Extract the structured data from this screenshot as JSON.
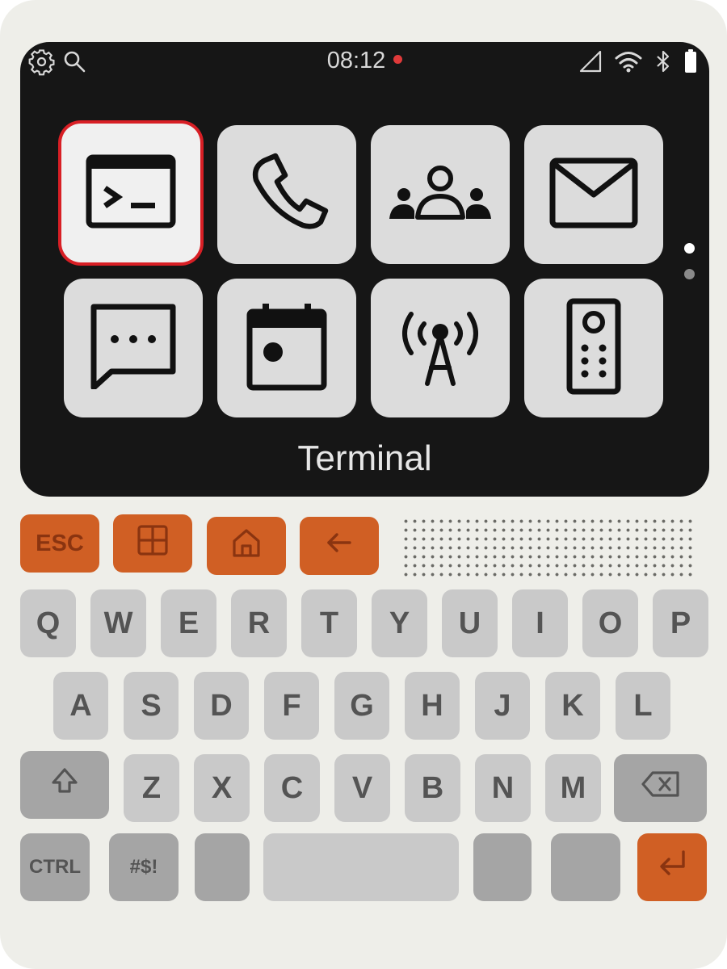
{
  "status_bar": {
    "time": "08:12",
    "icons": [
      "gear-icon",
      "search-icon",
      "cell-signal-icon",
      "wifi-icon",
      "bluetooth-icon",
      "battery-icon"
    ],
    "recording_color": "#e03a3a"
  },
  "apps": [
    {
      "icon": "terminal-icon",
      "name": "Terminal",
      "selected": true
    },
    {
      "icon": "phone-icon"
    },
    {
      "icon": "contacts-icon"
    },
    {
      "icon": "mail-icon"
    },
    {
      "icon": "messages-icon"
    },
    {
      "icon": "calendar-icon"
    },
    {
      "icon": "radio-tower-icon"
    },
    {
      "icon": "remote-icon"
    }
  ],
  "selected_app_label": "Terminal",
  "pager": {
    "pages": 2,
    "current": 1
  },
  "function_keys": [
    {
      "label": "ESC"
    },
    {
      "icon": "grid-icon"
    },
    {
      "icon": "home-icon"
    },
    {
      "icon": "back-arrow-icon"
    }
  ],
  "keyboard": {
    "row1": [
      "Q",
      "W",
      "E",
      "R",
      "T",
      "Y",
      "U",
      "I",
      "O",
      "P"
    ],
    "row2": [
      "A",
      "S",
      "D",
      "F",
      "G",
      "H",
      "J",
      "K",
      "L"
    ],
    "row3": [
      "Z",
      "X",
      "C",
      "V",
      "B",
      "N",
      "M"
    ],
    "ctrl": "CTRL",
    "symbols": "#$!",
    "shift_icon": "shift-icon",
    "backspace_icon": "backspace-icon",
    "enter_icon": "enter-icon"
  },
  "colors": {
    "accent": "#d05f24",
    "selection": "#d81f25",
    "screen": "#161616",
    "body": "#eeeee9"
  }
}
